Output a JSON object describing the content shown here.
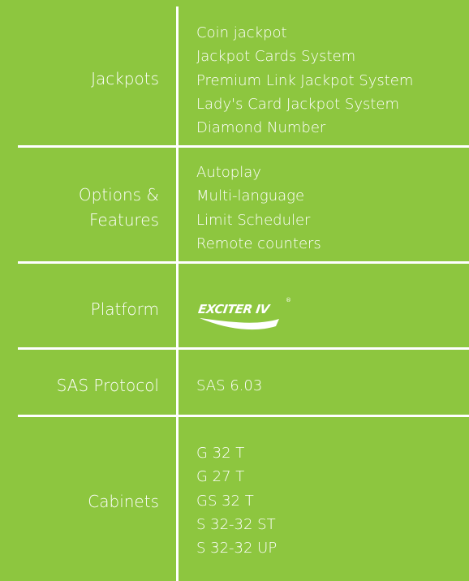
{
  "rows": [
    {
      "label": [
        "Jackpots"
      ],
      "values": [
        "Coin jackpot",
        "Jackpot Cards System",
        "Premium Link Jackpot System",
        "Lady's Card Jackpot System",
        "Diamond Number"
      ]
    },
    {
      "label": [
        "Options &",
        "Features"
      ],
      "values": [
        "Autoplay",
        "Multi-language",
        "Limit Scheduler",
        "Remote counters"
      ]
    },
    {
      "label": [
        "Platform"
      ],
      "logo_text": "EXCITER IV",
      "logo_mark": "®"
    },
    {
      "label": [
        "SAS Protocol"
      ],
      "values": [
        "SAS 6.03"
      ]
    },
    {
      "label": [
        "Cabinets"
      ],
      "values": [
        "G 32 T",
        "G 27 T",
        "GS 32 T",
        "S 32-32 ST",
        "S 32-32 UP"
      ]
    }
  ],
  "colors": {
    "background": "#8dc63f",
    "text": "#ffffff",
    "lines": "#ffffff"
  }
}
